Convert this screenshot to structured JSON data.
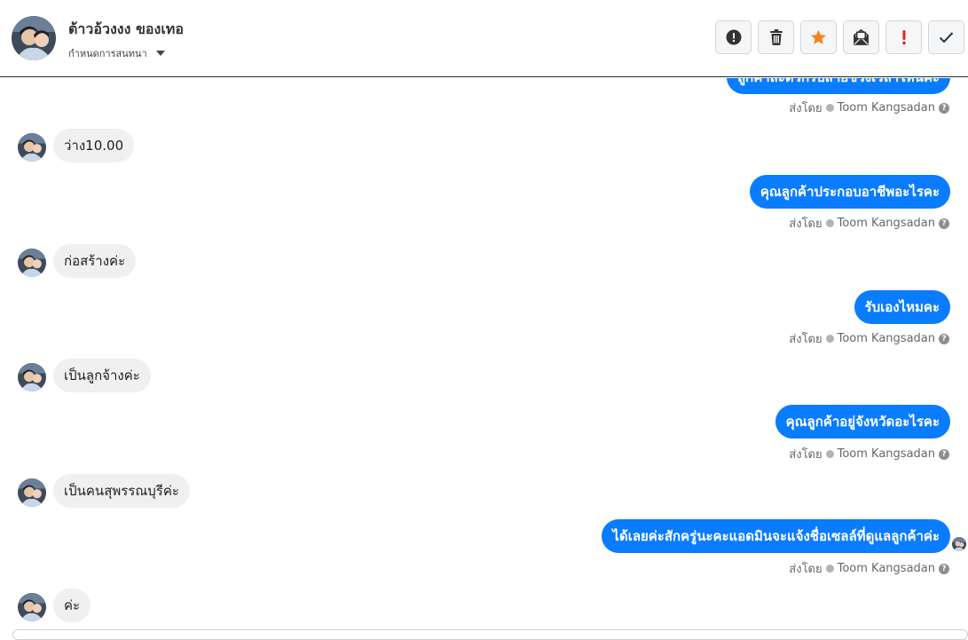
{
  "header": {
    "contact_name": "ต้าวอ้วงงง ของเทอ",
    "label_dropdown": "กำหนดการสนทนา"
  },
  "toolbar": {
    "buttons": [
      {
        "icon": "alert-circle-icon",
        "color": "#333333"
      },
      {
        "icon": "trash-icon",
        "color": "#333333"
      },
      {
        "icon": "star-icon",
        "color": "#f5821f"
      },
      {
        "icon": "mail-open-icon",
        "color": "#333333"
      },
      {
        "icon": "exclamation-icon",
        "color": "#e02424"
      },
      {
        "icon": "check-icon",
        "color": "#333333"
      }
    ]
  },
  "colors": {
    "outgoing_bubble": "#0a7cff",
    "incoming_bubble": "#f0f0f0"
  },
  "messages": [
    {
      "direction": "out",
      "text": "ลูกค้าสะดวกรับสายช่วงเวลาไหนคะ"
    },
    {
      "direction": "in",
      "text": "ว่าง10.00"
    },
    {
      "direction": "out",
      "text": "คุณลูกค้าประกอบอาชีพอะไรคะ"
    },
    {
      "direction": "in",
      "text": "ก่อสร้างค่ะ"
    },
    {
      "direction": "out",
      "text": "รับเองไหมคะ"
    },
    {
      "direction": "in",
      "text": "เป็นลูกจ้างค่ะ"
    },
    {
      "direction": "out",
      "text": "คุณลูกค้าอยู่จังหวัดอะไรคะ"
    },
    {
      "direction": "in",
      "text": "เป็นคนสุพรรณบุรีค่ะ"
    },
    {
      "direction": "out",
      "text": "ได้เลยค่ะสักครู่นะคะแอดมินจะแจ้งชื่อเซลล์ที่ดูแลลูกค้าค่ะ"
    },
    {
      "direction": "in",
      "text": "ค่ะ"
    }
  ],
  "sent_by": {
    "prefix": "ส่งโดย",
    "sender": "Toom Kangsadan"
  }
}
